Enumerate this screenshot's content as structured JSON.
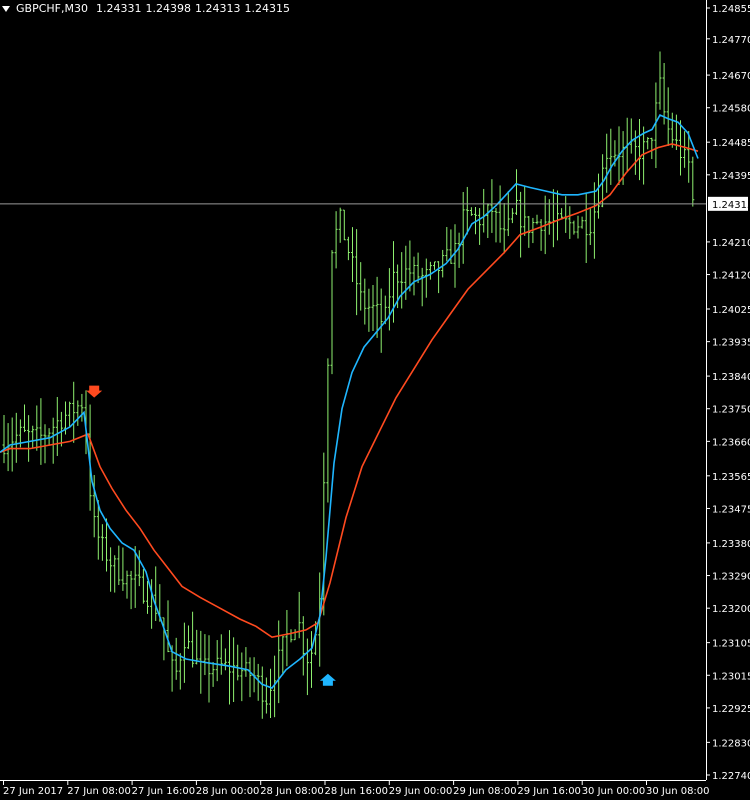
{
  "window": {
    "symbol_timeframe": "GBPCHF,M30",
    "open": "1.24331",
    "high": "1.24398",
    "low": "1.24313",
    "close": "1.24315"
  },
  "colors": {
    "background": "#000000",
    "axis": "#ffffff",
    "bars": "#8ef06f",
    "fast_ma": "#1fb6ff",
    "slow_ma": "#ff4a1f",
    "bid_line": "#9a9a9a",
    "price_label_bg": "#ffffff",
    "price_label_text": "#000000"
  },
  "icons": {
    "sell_signal": "red-down-arrow-icon",
    "buy_signal": "blue-up-arrow-icon",
    "header_menu": "triangle-down-icon"
  },
  "chart_data": {
    "type": "line",
    "price_axis_ticks": [
      "1.24855",
      "1.24770",
      "1.24670",
      "1.24580",
      "1.24485",
      "1.24395",
      "1.24210",
      "1.24120",
      "1.24025",
      "1.23935",
      "1.23840",
      "1.23750",
      "1.23660",
      "1.23565",
      "1.23475",
      "1.23380",
      "1.23290",
      "1.23200",
      "1.23105",
      "1.23015",
      "1.22925",
      "1.22830",
      "1.22740"
    ],
    "current_price": "1.24315",
    "time_axis_labels": [
      "27 Jun 2017",
      "27 Jun 08:00",
      "27 Jun 16:00",
      "28 Jun 00:00",
      "28 Jun 08:00",
      "28 Jun 16:00",
      "29 Jun 00:00",
      "29 Jun 08:00",
      "29 Jun 16:00",
      "30 Jun 00:00",
      "30 Jun 08:00"
    ],
    "bar_count": 169,
    "close_path": [
      [
        0,
        1.2365
      ],
      [
        20,
        1.2368
      ],
      [
        40,
        1.2367
      ],
      [
        60,
        1.2372
      ],
      [
        84,
        1.2377
      ],
      [
        88,
        1.2361
      ],
      [
        92,
        1.2345
      ],
      [
        100,
        1.2338
      ],
      [
        112,
        1.2332
      ],
      [
        128,
        1.2328
      ],
      [
        140,
        1.2326
      ],
      [
        152,
        1.2322
      ],
      [
        162,
        1.2317
      ],
      [
        170,
        1.2304
      ],
      [
        176,
        1.2302
      ],
      [
        184,
        1.2312
      ],
      [
        200,
        1.2303
      ],
      [
        220,
        1.2304
      ],
      [
        240,
        1.2303
      ],
      [
        256,
        1.2301
      ],
      [
        266,
        1.2295
      ],
      [
        274,
        1.2302
      ],
      [
        286,
        1.2312
      ],
      [
        298,
        1.2317
      ],
      [
        306,
        1.2306
      ],
      [
        314,
        1.2309
      ],
      [
        320,
        1.2325
      ],
      [
        326,
        1.2375
      ],
      [
        332,
        1.242
      ],
      [
        340,
        1.2427
      ],
      [
        350,
        1.2417
      ],
      [
        362,
        1.2404
      ],
      [
        376,
        1.2402
      ],
      [
        384,
        1.2398
      ],
      [
        392,
        1.2411
      ],
      [
        408,
        1.2413
      ],
      [
        424,
        1.2411
      ],
      [
        440,
        1.2414
      ],
      [
        456,
        1.2419
      ],
      [
        464,
        1.2428
      ],
      [
        472,
        1.2428
      ],
      [
        482,
        1.2427
      ],
      [
        492,
        1.243
      ],
      [
        504,
        1.2422
      ],
      [
        516,
        1.243
      ],
      [
        526,
        1.2425
      ],
      [
        540,
        1.2427
      ],
      [
        556,
        1.2426
      ],
      [
        572,
        1.2426
      ],
      [
        590,
        1.2426
      ],
      [
        598,
        1.2433
      ],
      [
        606,
        1.2446
      ],
      [
        616,
        1.2446
      ],
      [
        628,
        1.2446
      ],
      [
        640,
        1.2446
      ],
      [
        650,
        1.2448
      ],
      [
        660,
        1.2464
      ],
      [
        666,
        1.2453
      ],
      [
        676,
        1.2448
      ],
      [
        684,
        1.2444
      ],
      [
        690,
        1.2442
      ],
      [
        694,
        1.2428
      ],
      [
        698,
        1.2431
      ]
    ],
    "fast_ma": [
      [
        0,
        1.2363
      ],
      [
        10,
        1.2365
      ],
      [
        30,
        1.2366
      ],
      [
        50,
        1.2367
      ],
      [
        70,
        1.237
      ],
      [
        84,
        1.2374
      ],
      [
        92,
        1.2355
      ],
      [
        100,
        1.2347
      ],
      [
        110,
        1.2342
      ],
      [
        122,
        1.2338
      ],
      [
        134,
        1.2336
      ],
      [
        146,
        1.233
      ],
      [
        154,
        1.2322
      ],
      [
        162,
        1.2316
      ],
      [
        172,
        1.2308
      ],
      [
        186,
        1.2306
      ],
      [
        206,
        1.2305
      ],
      [
        230,
        1.2304
      ],
      [
        248,
        1.2303
      ],
      [
        262,
        1.2299
      ],
      [
        272,
        1.2298
      ],
      [
        286,
        1.2303
      ],
      [
        300,
        1.2306
      ],
      [
        312,
        1.2309
      ],
      [
        320,
        1.2318
      ],
      [
        326,
        1.2334
      ],
      [
        334,
        1.236
      ],
      [
        342,
        1.2375
      ],
      [
        352,
        1.2385
      ],
      [
        364,
        1.2392
      ],
      [
        376,
        1.2396
      ],
      [
        388,
        1.24
      ],
      [
        400,
        1.2406
      ],
      [
        414,
        1.241
      ],
      [
        430,
        1.2412
      ],
      [
        446,
        1.2415
      ],
      [
        458,
        1.2419
      ],
      [
        472,
        1.2426
      ],
      [
        484,
        1.2428
      ],
      [
        496,
        1.2431
      ],
      [
        506,
        1.2434
      ],
      [
        516,
        1.2437
      ],
      [
        530,
        1.2436
      ],
      [
        546,
        1.2435
      ],
      [
        562,
        1.2434
      ],
      [
        578,
        1.2434
      ],
      [
        596,
        1.2435
      ],
      [
        604,
        1.2438
      ],
      [
        612,
        1.2442
      ],
      [
        622,
        1.2446
      ],
      [
        632,
        1.2449
      ],
      [
        644,
        1.2451
      ],
      [
        652,
        1.2452
      ],
      [
        660,
        1.2456
      ],
      [
        668,
        1.2455
      ],
      [
        678,
        1.2454
      ],
      [
        688,
        1.2451
      ],
      [
        698,
        1.2444
      ]
    ],
    "slow_ma": [
      [
        0,
        1.2363
      ],
      [
        10,
        1.2364
      ],
      [
        30,
        1.2364
      ],
      [
        50,
        1.2365
      ],
      [
        70,
        1.2366
      ],
      [
        88,
        1.2368
      ],
      [
        100,
        1.2359
      ],
      [
        112,
        1.2353
      ],
      [
        126,
        1.2347
      ],
      [
        140,
        1.2342
      ],
      [
        154,
        1.2336
      ],
      [
        168,
        1.2331
      ],
      [
        182,
        1.2326
      ],
      [
        200,
        1.2323
      ],
      [
        220,
        1.232
      ],
      [
        240,
        1.2317
      ],
      [
        256,
        1.2315
      ],
      [
        272,
        1.2312
      ],
      [
        290,
        1.2313
      ],
      [
        306,
        1.2314
      ],
      [
        318,
        1.2316
      ],
      [
        330,
        1.2327
      ],
      [
        346,
        1.2345
      ],
      [
        362,
        1.2359
      ],
      [
        378,
        1.2368
      ],
      [
        396,
        1.2378
      ],
      [
        414,
        1.2386
      ],
      [
        432,
        1.2394
      ],
      [
        450,
        1.2401
      ],
      [
        468,
        1.2408
      ],
      [
        486,
        1.2413
      ],
      [
        504,
        1.2418
      ],
      [
        520,
        1.2423
      ],
      [
        540,
        1.2425
      ],
      [
        558,
        1.2427
      ],
      [
        578,
        1.2429
      ],
      [
        596,
        1.2431
      ],
      [
        610,
        1.2434
      ],
      [
        626,
        1.244
      ],
      [
        642,
        1.2445
      ],
      [
        658,
        1.2447
      ],
      [
        672,
        1.2448
      ],
      [
        686,
        1.2447
      ],
      [
        698,
        1.2446
      ]
    ],
    "signals": [
      {
        "type": "sell",
        "time_index": 22,
        "price": 1.238
      },
      {
        "type": "buy",
        "time_index": 79,
        "price": 1.23
      }
    ]
  }
}
